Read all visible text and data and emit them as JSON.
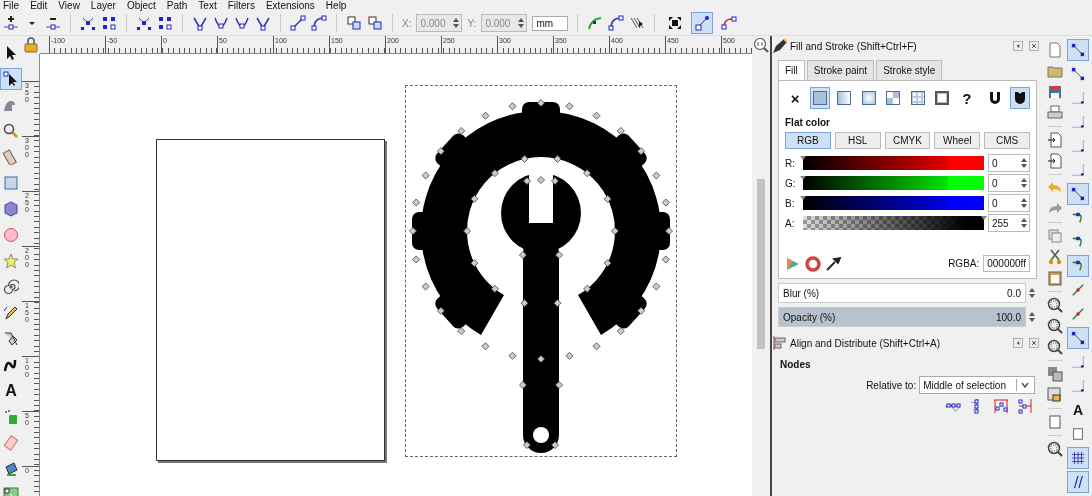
{
  "menu": [
    "File",
    "Edit",
    "View",
    "Layer",
    "Object",
    "Path",
    "Text",
    "Filters",
    "Extensions",
    "Help"
  ],
  "tool_controls": {
    "x_label": "X:",
    "x_value": "0.000",
    "y_label": "Y:",
    "y_value": "0.000",
    "unit": "mm",
    "toggles": [
      {
        "selected": false
      },
      {
        "selected": true
      },
      {
        "selected": false
      }
    ]
  },
  "tools": [
    {
      "selected": false
    },
    {
      "selected": true
    },
    {
      "selected": false
    },
    {
      "selected": false
    },
    {
      "selected": false
    },
    {
      "selected": false
    },
    {
      "selected": false
    },
    {
      "selected": false
    },
    {
      "selected": false
    },
    {
      "selected": false
    },
    {
      "selected": false
    },
    {
      "selected": false
    },
    {
      "selected": false
    },
    {
      "selected": false,
      "glyph": "A"
    },
    {
      "selected": false
    },
    {
      "selected": false
    },
    {
      "selected": false
    },
    {
      "selected": false
    }
  ],
  "rulers": {
    "horizontal": [
      "-100",
      "-50",
      "0",
      "50",
      "100",
      "150",
      "200",
      "250",
      "300",
      "350",
      "400",
      "450",
      "500"
    ],
    "vertical": [
      "350",
      "300",
      "250",
      "200",
      "150",
      "100",
      "50",
      "0"
    ]
  },
  "fill_stroke": {
    "title": "Fill and Stroke (Shift+Ctrl+F)",
    "tabs": [
      {
        "label": "Fill",
        "selected": true
      },
      {
        "label": "Stroke paint",
        "selected": false
      },
      {
        "label": "Stroke style",
        "selected": false
      }
    ],
    "paint_types": [
      {
        "kind": "none",
        "symbol": "×",
        "selected": false
      },
      {
        "kind": "flat",
        "selected": true
      },
      {
        "kind": "linear",
        "selected": false
      },
      {
        "kind": "radial",
        "selected": false
      },
      {
        "kind": "mesh",
        "selected": false
      },
      {
        "kind": "pattern",
        "selected": false
      },
      {
        "kind": "swatch",
        "selected": false
      },
      {
        "kind": "unset",
        "symbol": "?",
        "selected": false
      }
    ],
    "fill_rules": [
      {
        "kind": "evenodd",
        "selected": false
      },
      {
        "kind": "nonzero",
        "selected": true
      }
    ],
    "section": "Flat color",
    "modes": [
      {
        "label": "RGB",
        "selected": true
      },
      {
        "label": "HSL",
        "selected": false
      },
      {
        "label": "CMYK",
        "selected": false
      },
      {
        "label": "Wheel",
        "selected": false
      },
      {
        "label": "CMS",
        "selected": false
      }
    ],
    "channels": [
      {
        "kind": "color",
        "label": "R:",
        "value": "0",
        "level": 0,
        "color": "#ff0000"
      },
      {
        "kind": "color",
        "label": "G:",
        "value": "0",
        "level": 0,
        "color": "#00ff00"
      },
      {
        "kind": "color",
        "label": "B:",
        "value": "0",
        "level": 0,
        "color": "#0000ff"
      },
      {
        "kind": "alpha",
        "label": "A:",
        "value": "255",
        "level": 1,
        "color": "#000000"
      }
    ],
    "rgba_label": "RGBA:",
    "rgba_value": "000000ff",
    "blur": {
      "label": "Blur (%)",
      "value": "0.0",
      "level": 0
    },
    "opacity": {
      "label": "Opacity (%)",
      "value": "100.0",
      "level": 1
    }
  },
  "align": {
    "title": "Align and Distribute (Shift+Ctrl+A)",
    "section": "Nodes",
    "relative_label": "Relative to:",
    "relative_value": "Middle of selection"
  },
  "snap": [
    {
      "on": true
    },
    {
      "on": false
    },
    {
      "on": false
    },
    {
      "on": false
    },
    {
      "on": false
    },
    {
      "on": false
    },
    {
      "on": true
    },
    {
      "on": false
    },
    {
      "on": false
    },
    {
      "on": true
    },
    {
      "on": false
    },
    {
      "on": false
    },
    {
      "on": true
    },
    {
      "on": false
    },
    {
      "on": false
    },
    {
      "on": false,
      "glyph": "A"
    },
    {
      "on": false
    },
    {
      "on": true
    },
    {
      "on": true
    }
  ]
}
